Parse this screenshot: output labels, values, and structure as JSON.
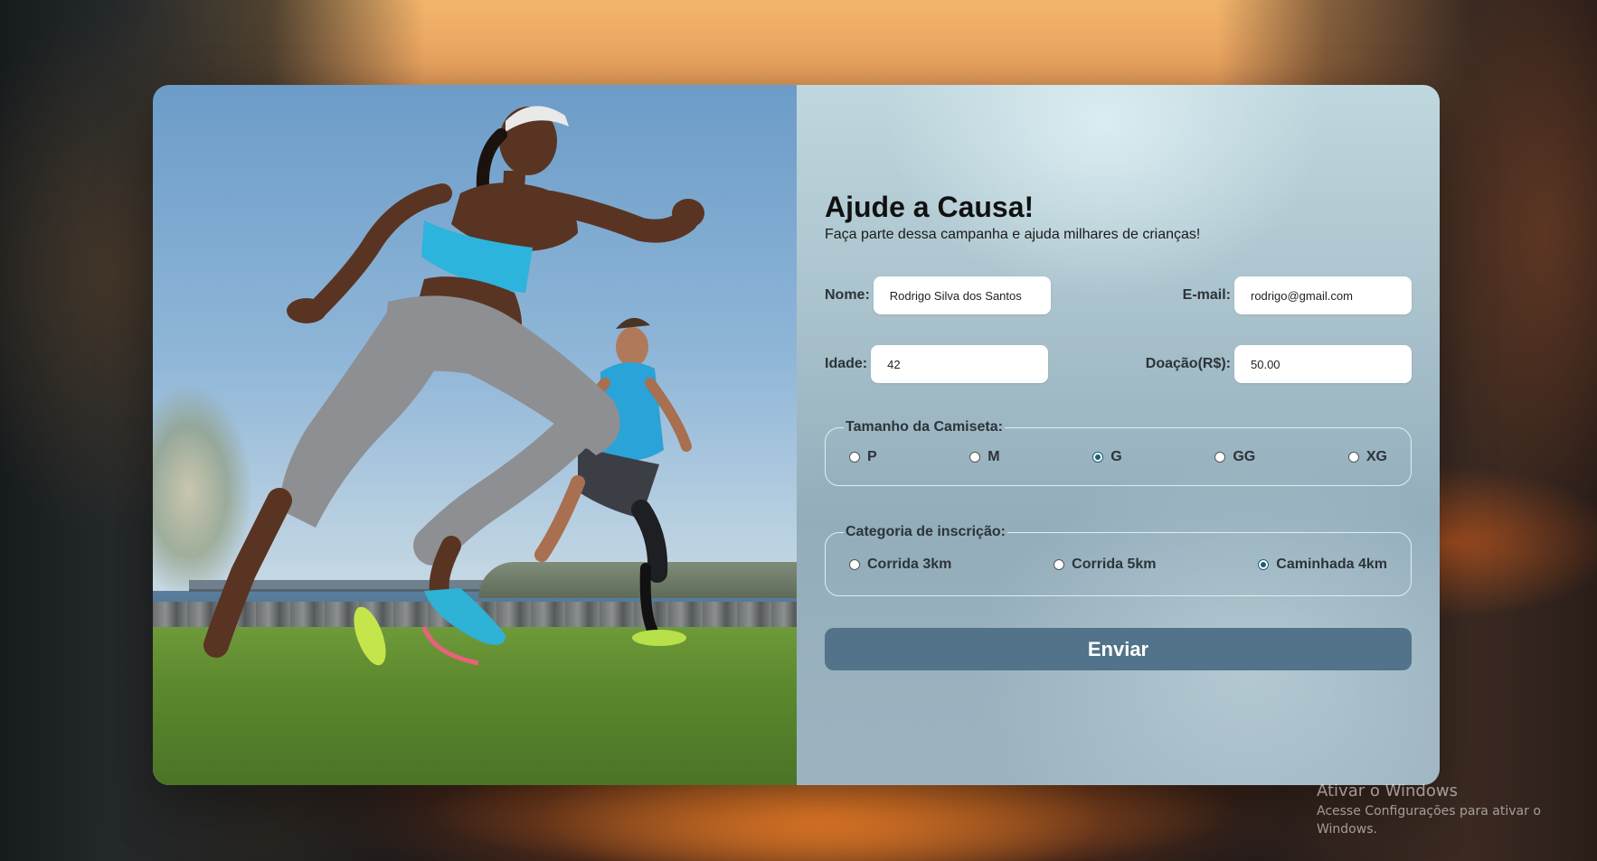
{
  "form": {
    "title": "Ajude a Causa!",
    "subtitle": "Faça parte dessa campanha e ajuda milhares de crianças!",
    "fields": {
      "nome": {
        "label": "Nome:",
        "value": "Rodrigo Silva dos Santos"
      },
      "email": {
        "label": "E-mail:",
        "value": "rodrigo@gmail.com"
      },
      "idade": {
        "label": "Idade:",
        "value": "42"
      },
      "doacao": {
        "label": "Doação(R$):",
        "value": "50.00"
      }
    },
    "shirt_size": {
      "legend": "Tamanho da Camiseta:",
      "options": [
        "P",
        "M",
        "G",
        "GG",
        "XG"
      ],
      "selected": "G"
    },
    "category": {
      "legend": "Categoria de inscrição:",
      "options": [
        "Corrida 3km",
        "Corrida 5km",
        "Caminhada 4km"
      ],
      "selected": "Caminhada 4km"
    },
    "submit_label": "Enviar"
  },
  "hero_image": {
    "subject": "two runners sprinting on grass by the bay"
  },
  "watermark": {
    "line1": "Ativar o Windows",
    "line2": "Acesse Configurações para ativar o Windows."
  },
  "colors": {
    "button": "#527389",
    "radio_selected": "#1a5f7a",
    "fieldset_border": "#dfeff2"
  }
}
